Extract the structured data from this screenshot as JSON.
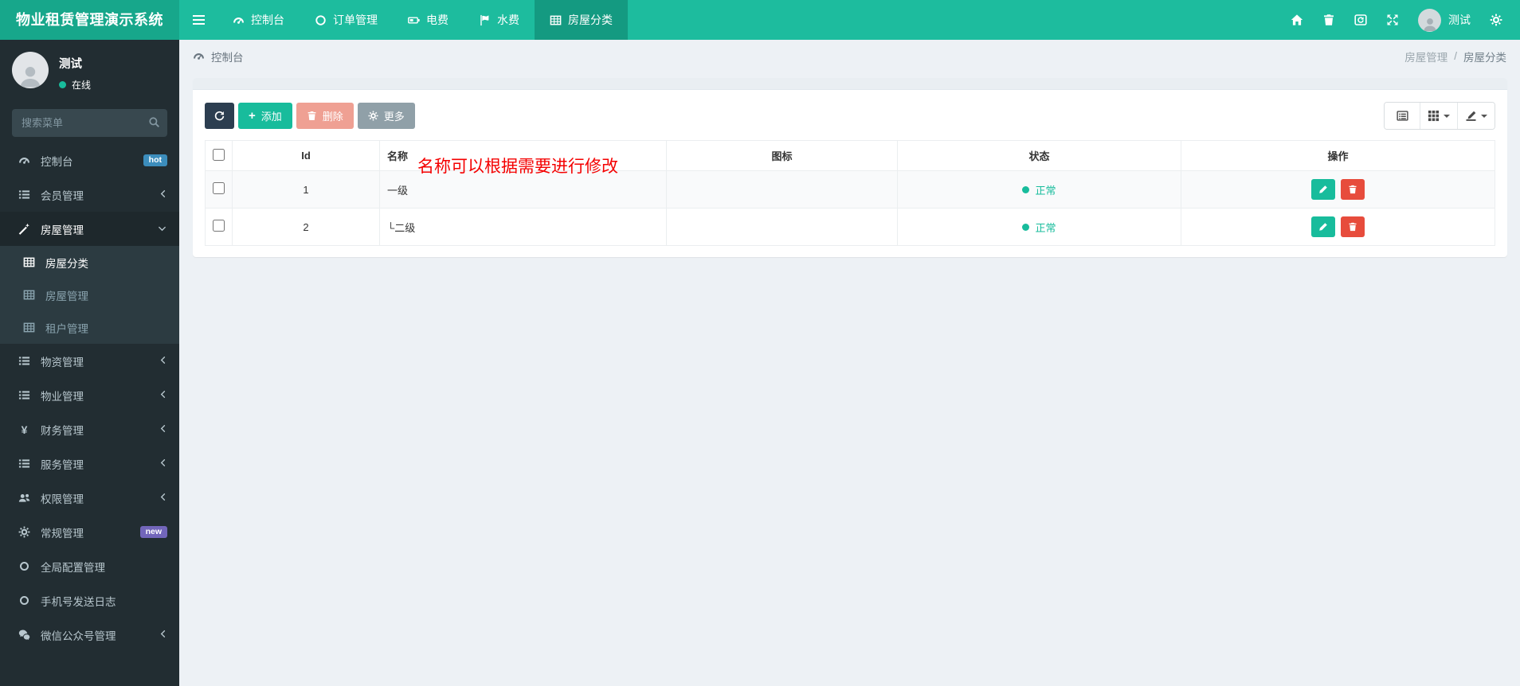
{
  "navbar": {
    "brand": "物业租赁管理演示系统",
    "tabs": [
      {
        "label": "控制台"
      },
      {
        "label": "订单管理"
      },
      {
        "label": "电费"
      },
      {
        "label": "水费"
      },
      {
        "label": "房屋分类"
      }
    ],
    "user_name": "测试"
  },
  "sidebar": {
    "user_name": "测试",
    "user_status": "在线",
    "search_placeholder": "搜索菜单",
    "items": [
      {
        "label": "控制台",
        "badge": "hot"
      },
      {
        "label": "会员管理"
      },
      {
        "label": "房屋管理"
      },
      {
        "label": "房屋分类"
      },
      {
        "label": "房屋管理"
      },
      {
        "label": "租户管理"
      },
      {
        "label": "物资管理"
      },
      {
        "label": "物业管理"
      },
      {
        "label": "财务管理"
      },
      {
        "label": "服务管理"
      },
      {
        "label": "权限管理"
      },
      {
        "label": "常规管理",
        "badge": "new"
      },
      {
        "label": "全局配置管理"
      },
      {
        "label": "手机号发送日志"
      },
      {
        "label": "微信公众号管理"
      }
    ]
  },
  "breadcrumb": {
    "current": "控制台",
    "parent": "房屋管理",
    "page": "房屋分类",
    "separator": "/"
  },
  "toolbar": {
    "add_label": "添加",
    "delete_label": "删除",
    "more_label": "更多"
  },
  "table": {
    "headers": {
      "id": "Id",
      "name": "名称",
      "icon": "图标",
      "status": "状态",
      "ops": "操作"
    },
    "rows": [
      {
        "id": "1",
        "name": "一级",
        "status": "正常"
      },
      {
        "id": "2",
        "name": "└二级",
        "status": "正常"
      }
    ]
  },
  "annotation": "名称可以根据需要进行修改",
  "icons": {
    "yen": "¥"
  },
  "colors": {
    "navbar": "#1dbc9e",
    "brand_bg": "#17a78b",
    "sidebar_bg": "#222d32",
    "success": "#18bc9c",
    "danger": "#e74c3c",
    "primary_btn": "#2c3e50",
    "hot_badge": "#3c8dbc",
    "new_badge": "#7266ba",
    "annotation_red": "#f40000"
  }
}
